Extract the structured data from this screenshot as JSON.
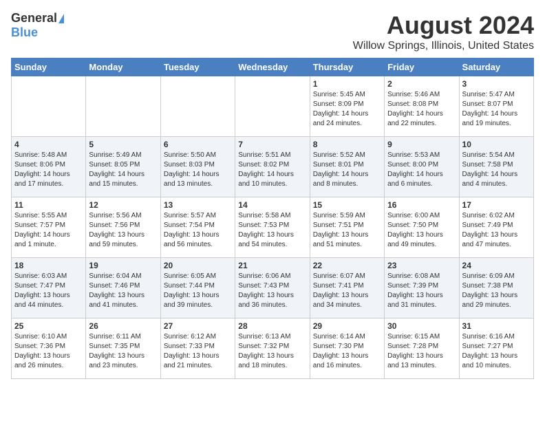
{
  "header": {
    "logo_general": "General",
    "logo_blue": "Blue",
    "title": "August 2024",
    "subtitle": "Willow Springs, Illinois, United States"
  },
  "weekdays": [
    "Sunday",
    "Monday",
    "Tuesday",
    "Wednesday",
    "Thursday",
    "Friday",
    "Saturday"
  ],
  "weeks": [
    [
      {
        "day": "",
        "info": ""
      },
      {
        "day": "",
        "info": ""
      },
      {
        "day": "",
        "info": ""
      },
      {
        "day": "",
        "info": ""
      },
      {
        "day": "1",
        "info": "Sunrise: 5:45 AM\nSunset: 8:09 PM\nDaylight: 14 hours\nand 24 minutes."
      },
      {
        "day": "2",
        "info": "Sunrise: 5:46 AM\nSunset: 8:08 PM\nDaylight: 14 hours\nand 22 minutes."
      },
      {
        "day": "3",
        "info": "Sunrise: 5:47 AM\nSunset: 8:07 PM\nDaylight: 14 hours\nand 19 minutes."
      }
    ],
    [
      {
        "day": "4",
        "info": "Sunrise: 5:48 AM\nSunset: 8:06 PM\nDaylight: 14 hours\nand 17 minutes."
      },
      {
        "day": "5",
        "info": "Sunrise: 5:49 AM\nSunset: 8:05 PM\nDaylight: 14 hours\nand 15 minutes."
      },
      {
        "day": "6",
        "info": "Sunrise: 5:50 AM\nSunset: 8:03 PM\nDaylight: 14 hours\nand 13 minutes."
      },
      {
        "day": "7",
        "info": "Sunrise: 5:51 AM\nSunset: 8:02 PM\nDaylight: 14 hours\nand 10 minutes."
      },
      {
        "day": "8",
        "info": "Sunrise: 5:52 AM\nSunset: 8:01 PM\nDaylight: 14 hours\nand 8 minutes."
      },
      {
        "day": "9",
        "info": "Sunrise: 5:53 AM\nSunset: 8:00 PM\nDaylight: 14 hours\nand 6 minutes."
      },
      {
        "day": "10",
        "info": "Sunrise: 5:54 AM\nSunset: 7:58 PM\nDaylight: 14 hours\nand 4 minutes."
      }
    ],
    [
      {
        "day": "11",
        "info": "Sunrise: 5:55 AM\nSunset: 7:57 PM\nDaylight: 14 hours\nand 1 minute."
      },
      {
        "day": "12",
        "info": "Sunrise: 5:56 AM\nSunset: 7:56 PM\nDaylight: 13 hours\nand 59 minutes."
      },
      {
        "day": "13",
        "info": "Sunrise: 5:57 AM\nSunset: 7:54 PM\nDaylight: 13 hours\nand 56 minutes."
      },
      {
        "day": "14",
        "info": "Sunrise: 5:58 AM\nSunset: 7:53 PM\nDaylight: 13 hours\nand 54 minutes."
      },
      {
        "day": "15",
        "info": "Sunrise: 5:59 AM\nSunset: 7:51 PM\nDaylight: 13 hours\nand 51 minutes."
      },
      {
        "day": "16",
        "info": "Sunrise: 6:00 AM\nSunset: 7:50 PM\nDaylight: 13 hours\nand 49 minutes."
      },
      {
        "day": "17",
        "info": "Sunrise: 6:02 AM\nSunset: 7:49 PM\nDaylight: 13 hours\nand 47 minutes."
      }
    ],
    [
      {
        "day": "18",
        "info": "Sunrise: 6:03 AM\nSunset: 7:47 PM\nDaylight: 13 hours\nand 44 minutes."
      },
      {
        "day": "19",
        "info": "Sunrise: 6:04 AM\nSunset: 7:46 PM\nDaylight: 13 hours\nand 41 minutes."
      },
      {
        "day": "20",
        "info": "Sunrise: 6:05 AM\nSunset: 7:44 PM\nDaylight: 13 hours\nand 39 minutes."
      },
      {
        "day": "21",
        "info": "Sunrise: 6:06 AM\nSunset: 7:43 PM\nDaylight: 13 hours\nand 36 minutes."
      },
      {
        "day": "22",
        "info": "Sunrise: 6:07 AM\nSunset: 7:41 PM\nDaylight: 13 hours\nand 34 minutes."
      },
      {
        "day": "23",
        "info": "Sunrise: 6:08 AM\nSunset: 7:39 PM\nDaylight: 13 hours\nand 31 minutes."
      },
      {
        "day": "24",
        "info": "Sunrise: 6:09 AM\nSunset: 7:38 PM\nDaylight: 13 hours\nand 29 minutes."
      }
    ],
    [
      {
        "day": "25",
        "info": "Sunrise: 6:10 AM\nSunset: 7:36 PM\nDaylight: 13 hours\nand 26 minutes."
      },
      {
        "day": "26",
        "info": "Sunrise: 6:11 AM\nSunset: 7:35 PM\nDaylight: 13 hours\nand 23 minutes."
      },
      {
        "day": "27",
        "info": "Sunrise: 6:12 AM\nSunset: 7:33 PM\nDaylight: 13 hours\nand 21 minutes."
      },
      {
        "day": "28",
        "info": "Sunrise: 6:13 AM\nSunset: 7:32 PM\nDaylight: 13 hours\nand 18 minutes."
      },
      {
        "day": "29",
        "info": "Sunrise: 6:14 AM\nSunset: 7:30 PM\nDaylight: 13 hours\nand 16 minutes."
      },
      {
        "day": "30",
        "info": "Sunrise: 6:15 AM\nSunset: 7:28 PM\nDaylight: 13 hours\nand 13 minutes."
      },
      {
        "day": "31",
        "info": "Sunrise: 6:16 AM\nSunset: 7:27 PM\nDaylight: 13 hours\nand 10 minutes."
      }
    ]
  ]
}
